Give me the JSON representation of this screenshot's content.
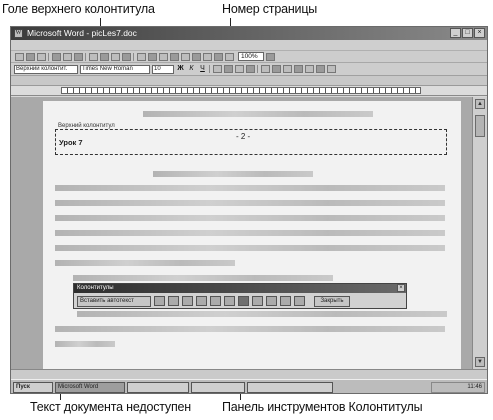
{
  "callouts": {
    "header_pane": "Голе верхнего колонтитула",
    "page_number": "Номер страницы",
    "doc_unavailable": "Текст документа недоступен",
    "hf_toolbar": "Панель инструментов Колонтитулы"
  },
  "window": {
    "title": "Microsoft Word - picLes7.doc"
  },
  "toolbar": {
    "zoom": "100%"
  },
  "formatting": {
    "style": "Верхний колонтит.",
    "font": "Times New Roman",
    "size": "10"
  },
  "document": {
    "header_label": "Верхний колонтитул",
    "header_text": "Урок 7",
    "page_number": "- 2 -"
  },
  "hf_toolbar": {
    "title": "Колонтитулы",
    "insert_autotext": "Вставить автотекст",
    "close": "Закрыть"
  },
  "taskbar": {
    "start": "Пуск",
    "word_task": "Microsoft Word",
    "clock": "11:46"
  },
  "colors": {
    "titlebar": "#3c3c3c",
    "page": "#f2f2f2",
    "workspace": "#a9a9a9"
  }
}
